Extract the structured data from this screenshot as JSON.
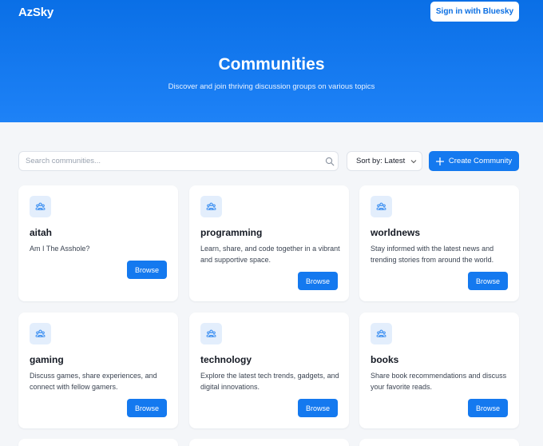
{
  "header": {
    "brand": "AzSky",
    "signin_label": "Sign in with Bluesky"
  },
  "hero": {
    "title": "Communities",
    "subtitle": "Discover and join thriving discussion groups on various topics"
  },
  "toolbar": {
    "search_placeholder": "Search communities...",
    "sort_label": "Sort by: Latest",
    "create_label": "Create Community"
  },
  "communities": [
    {
      "name": "aitah",
      "description": "Am I The Asshole?",
      "browse_label": "Browse",
      "icon": "users-icon"
    },
    {
      "name": "programming",
      "description": "Learn, share, and code together in a vibrant and supportive space.",
      "browse_label": "Browse",
      "icon": "users-icon"
    },
    {
      "name": "worldnews",
      "description": "Stay informed with the latest news and trending stories from around the world.",
      "browse_label": "Browse",
      "icon": "users-icon"
    },
    {
      "name": "gaming",
      "description": "Discuss games, share experiences, and connect with fellow gamers.",
      "browse_label": "Browse",
      "icon": "users-icon"
    },
    {
      "name": "technology",
      "description": "Explore the latest tech trends, gadgets, and digital innovations.",
      "browse_label": "Browse",
      "icon": "users-icon"
    },
    {
      "name": "books",
      "description": "Share book recommendations and discuss your favorite reads.",
      "browse_label": "Browse",
      "icon": "users-icon"
    }
  ],
  "colors": {
    "accent": "#1479ef",
    "hero_top": "#0a6fe6",
    "hero_bottom": "#1e82f7",
    "page_bg": "#f4f6f9",
    "icon_bg": "#e3eefc"
  }
}
